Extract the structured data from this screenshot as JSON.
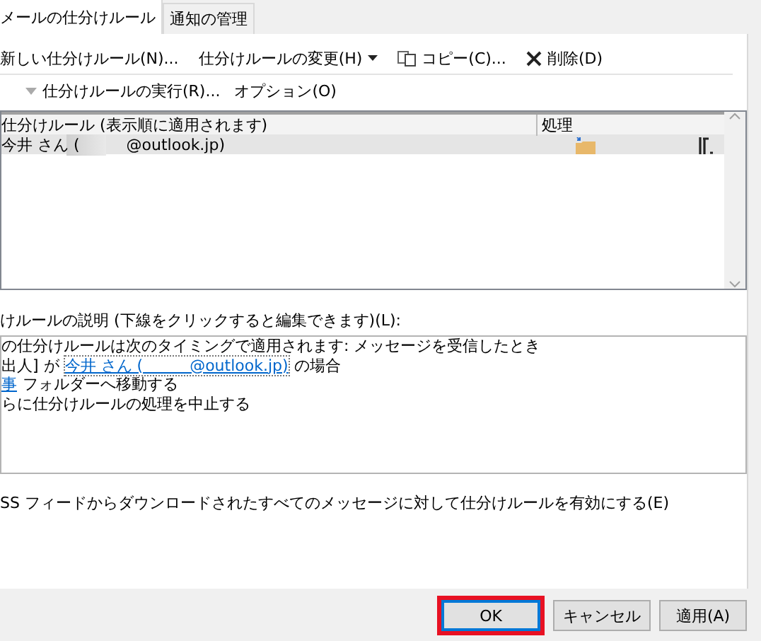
{
  "tabs": [
    {
      "label": "メールの仕分けルール",
      "selected": true
    },
    {
      "label": "通知の管理",
      "selected": false
    }
  ],
  "toolbar": [
    {
      "label": "新しい仕分けルール(N)...",
      "kind": "text"
    },
    {
      "label": "仕分けルールの変更(H)",
      "kind": "dropdown"
    },
    {
      "label": "コピー(C)...",
      "kind": "copy"
    },
    {
      "label": "削除(D)",
      "kind": "delete"
    }
  ],
  "run_bar": [
    {
      "label": "仕分けルールの実行(R)...",
      "kind": "run"
    },
    {
      "label": "オプション(O)",
      "kind": "text"
    }
  ],
  "rules_list": {
    "columns": [
      "仕分けルール (表示順に適用されます)",
      "処理"
    ],
    "rows": [
      {
        "name": "今井 さん (　　　@outlook.jp)",
        "selected": true
      }
    ]
  },
  "description": {
    "label": "けルールの説明 (下線をクリックすると編集できます)(L):",
    "lines": [
      [
        {
          "kind": "text",
          "text": "の仕分けルールは次のタイミングで適用されます: メッセージを受信したとき"
        }
      ],
      [
        {
          "kind": "text",
          "text": "出人] が"
        },
        {
          "kind": "link",
          "text": "今井 さん (　　　@outlook.jp)"
        },
        {
          "kind": "text",
          "text": "の場合"
        }
      ],
      [
        {
          "kind": "link",
          "text": "事"
        },
        {
          "kind": "text",
          "text": "フォルダーへ移動する"
        }
      ],
      [
        {
          "kind": "text",
          "text": "らに仕分けルールの処理を中止する"
        }
      ]
    ]
  },
  "rss_option": {
    "label": "SS フィードからダウンロードされたすべてのメッセージに対して仕分けルールを有効にする(E)"
  },
  "buttons": [
    {
      "label": "OK",
      "default": true,
      "highlighted": true
    },
    {
      "label": "キャンセル",
      "default": false,
      "highlighted": false
    },
    {
      "label": "適用(A)",
      "default": false,
      "highlighted": false
    }
  ]
}
